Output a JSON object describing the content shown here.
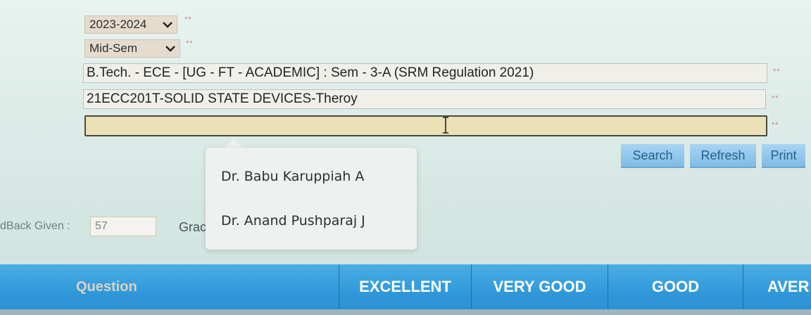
{
  "filters": {
    "academic_year": "2023-2024",
    "exam_type": "Mid-Sem",
    "required_marker": "**"
  },
  "fields": {
    "program": "B.Tech. - ECE - [UG - FT - ACADEMIC] :  Sem - 3-A (SRM Regulation 2021)",
    "course": "21ECC201T-SOLID STATE DEVICES-Theroy",
    "faculty": ""
  },
  "buttons": {
    "search": "Search",
    "refresh": "Refresh",
    "print": "Print"
  },
  "faculty_dropdown": {
    "options": [
      "Dr. Babu Karuppiah  A",
      "Dr. Anand Pushparaj J"
    ]
  },
  "feedback": {
    "label": "dBack Given :",
    "count": "57",
    "grade_label": "Grac"
  },
  "table": {
    "headers": [
      "Question",
      "EXCELLENT",
      "VERY GOOD",
      "GOOD",
      "AVER"
    ]
  }
}
